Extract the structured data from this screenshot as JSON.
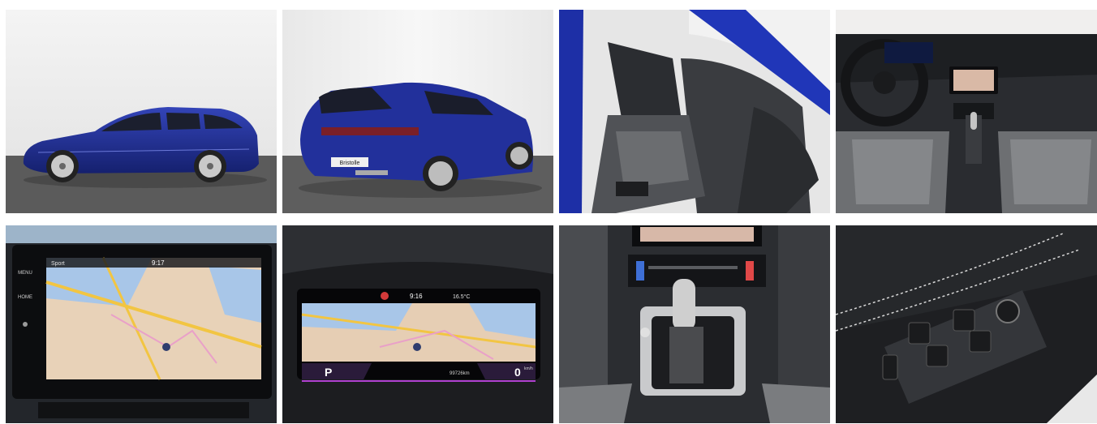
{
  "gallery": {
    "photos": [
      {
        "subject": "exterior side view, blue shooting brake"
      },
      {
        "subject": "exterior rear three-quarter view"
      },
      {
        "subject": "front seats interior"
      },
      {
        "subject": "cockpit and dashboard"
      },
      {
        "subject": "infotainment navigation screen"
      },
      {
        "subject": "digital instrument cluster with map"
      },
      {
        "subject": "center console, climate controls and gear selector"
      },
      {
        "subject": "door panel window switches"
      }
    ],
    "infotainment": {
      "menu_label": "MENU",
      "home_label": "HOME",
      "mode": "Sport",
      "time": "9:17"
    },
    "cluster": {
      "time": "9:16",
      "temperature": "16.5°C",
      "gear": "P",
      "speed": "0",
      "speed_unit": "km/h",
      "range": "99726km"
    },
    "plate": {
      "text": "Bristolle"
    }
  },
  "colors": {
    "car_blue": "#1f2f9c",
    "car_blue_dark": "#0f1a63",
    "studio_wall": "#eeeeee",
    "studio_floor": "#5d5d5d",
    "cabin_dark": "#2a2c30"
  }
}
